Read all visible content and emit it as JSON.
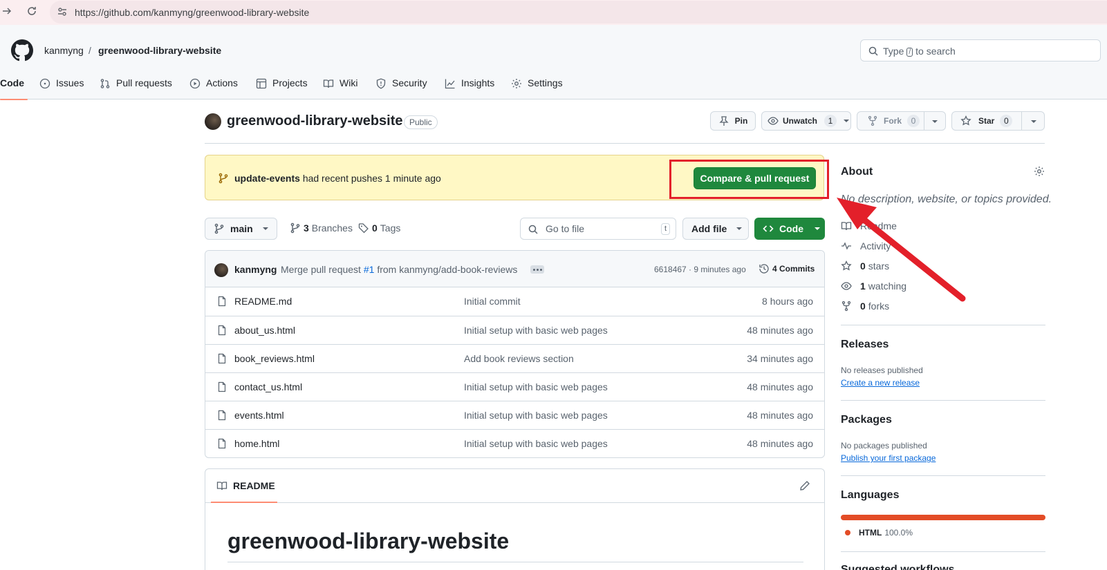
{
  "browser": {
    "url": "https://github.com/kanmyng/greenwood-library-website",
    "icons": [
      "forward-icon",
      "reload-icon",
      "site-info-icon"
    ]
  },
  "header": {
    "owner": "kanmyng",
    "separator": "/",
    "repo": "greenwood-library-website",
    "search_prefix": "Type",
    "search_key": "/",
    "search_suffix": "to search"
  },
  "tabs": [
    {
      "label": "Code",
      "icon": "code-icon"
    },
    {
      "label": "Issues",
      "icon": "issue-icon"
    },
    {
      "label": "Pull requests",
      "icon": "pull-request-icon"
    },
    {
      "label": "Actions",
      "icon": "play-icon"
    },
    {
      "label": "Projects",
      "icon": "table-icon"
    },
    {
      "label": "Wiki",
      "icon": "book-icon"
    },
    {
      "label": "Security",
      "icon": "shield-icon"
    },
    {
      "label": "Insights",
      "icon": "graph-icon"
    },
    {
      "label": "Settings",
      "icon": "gear-icon"
    }
  ],
  "repo": {
    "title": "greenwood-library-website",
    "visibility": "Public",
    "pin_label": "Pin",
    "unwatch_label": "Unwatch",
    "watch_count": "1",
    "fork_label": "Fork",
    "fork_count": "0",
    "star_label": "Star",
    "star_count": "0"
  },
  "banner": {
    "branch": "update-events",
    "text": "had recent pushes 1 minute ago",
    "button": "Compare & pull request"
  },
  "filenav": {
    "branch": "main",
    "branches_count": "3",
    "branches_label": "Branches",
    "tags_count": "0",
    "tags_label": "Tags",
    "goto_placeholder": "Go to file",
    "goto_key": "t",
    "add_file": "Add file",
    "code": "Code"
  },
  "commit": {
    "author": "kanmyng",
    "msg_prefix": "Merge pull request",
    "pr": "#1",
    "msg_suffix": "from kanmyng/add-book-reviews",
    "hash_time": "6618467 · 9 minutes ago",
    "commits": "4 Commits"
  },
  "files": [
    {
      "name": "README.md",
      "commit": "Initial commit",
      "date": "8 hours ago"
    },
    {
      "name": "about_us.html",
      "commit": "Initial setup with basic web pages",
      "date": "48 minutes ago"
    },
    {
      "name": "book_reviews.html",
      "commit": "Add book reviews section",
      "date": "34 minutes ago"
    },
    {
      "name": "contact_us.html",
      "commit": "Initial setup with basic web pages",
      "date": "48 minutes ago"
    },
    {
      "name": "events.html",
      "commit": "Initial setup with basic web pages",
      "date": "48 minutes ago"
    },
    {
      "name": "home.html",
      "commit": "Initial setup with basic web pages",
      "date": "48 minutes ago"
    }
  ],
  "readme": {
    "tab": "README",
    "heading": "greenwood-library-website"
  },
  "sidebar": {
    "about": "About",
    "description": "No description, website, or topics provided.",
    "readme": "Readme",
    "activity": "Activity",
    "stars_count": "0",
    "stars_label": "stars",
    "watching_count": "1",
    "watching_label": "watching",
    "forks_count": "0",
    "forks_label": "forks",
    "releases": "Releases",
    "no_releases": "No releases published",
    "create_release": "Create a new release",
    "packages": "Packages",
    "no_packages": "No packages published",
    "publish_package": "Publish your first package",
    "languages": "Languages",
    "lang_name": "HTML",
    "lang_pct": "100.0%",
    "next_heading": "Suggested workflows"
  },
  "colors": {
    "accent_green": "#1f883d",
    "annotation_red": "#e3202a",
    "html_lang": "#e34c26",
    "banner_yellow": "#fff8c5"
  }
}
